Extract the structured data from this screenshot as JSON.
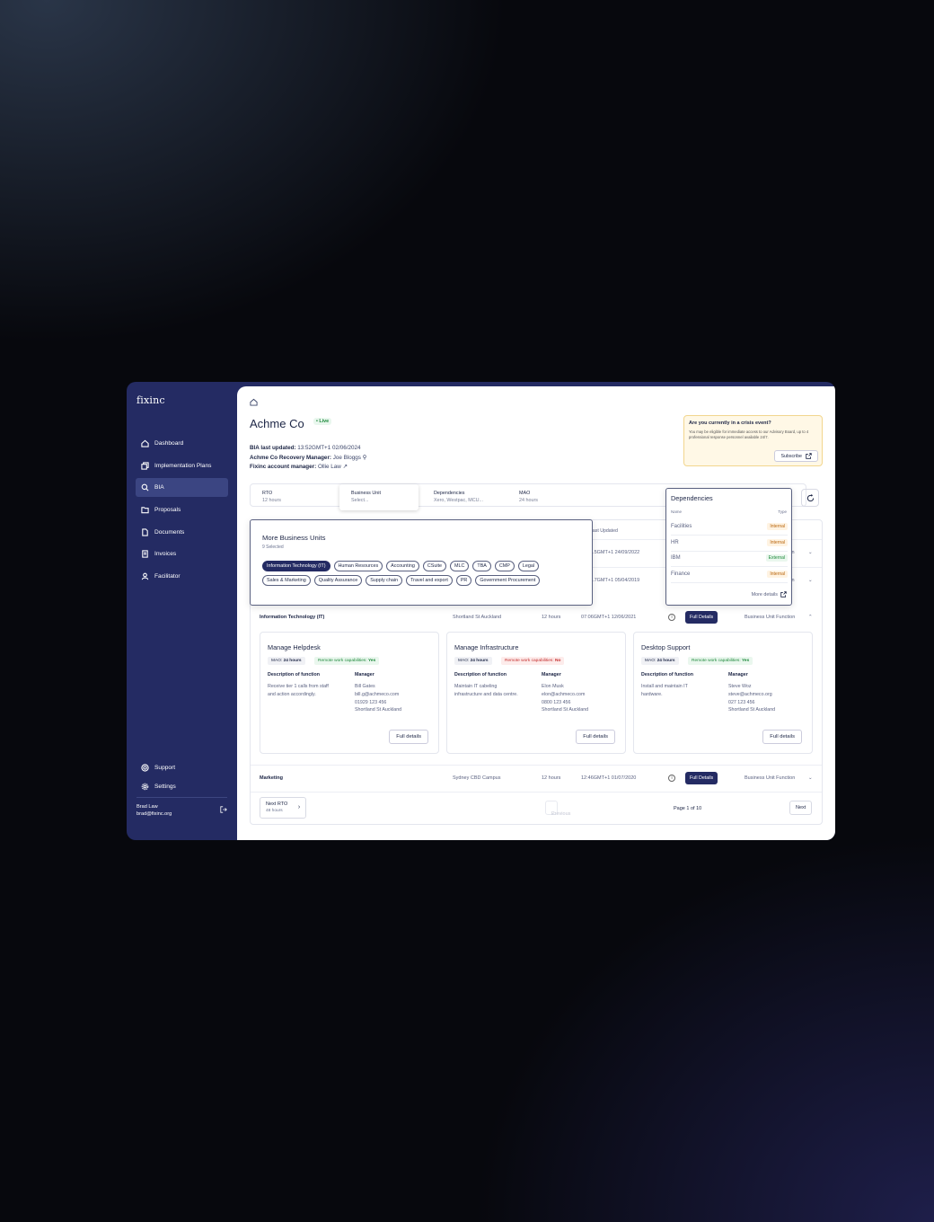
{
  "app": {
    "logo": "fixinc"
  },
  "sidebar": {
    "items": [
      {
        "label": "Dashboard",
        "icon": "home-icon"
      },
      {
        "label": "Implementation Plans",
        "icon": "layers-icon"
      },
      {
        "label": "BIA",
        "icon": "search-icon",
        "active": true
      },
      {
        "label": "Proposals",
        "icon": "folder-icon"
      },
      {
        "label": "Documents",
        "icon": "document-icon"
      },
      {
        "label": "Invoices",
        "icon": "invoice-icon"
      },
      {
        "label": "Facilitator",
        "icon": "user-icon"
      }
    ],
    "bottom": [
      {
        "label": "Support",
        "icon": "lifebuoy-icon"
      },
      {
        "label": "Settings",
        "icon": "gear-icon"
      }
    ],
    "user": {
      "name": "Brad Law",
      "email": "brad@fixinc.org"
    }
  },
  "header": {
    "title": "Achme Co",
    "status": "• Live",
    "bia_updated_label": "BIA last updated:",
    "bia_updated_value": "13:52GMT+1 02/06/2024",
    "recovery_manager_label": "Achme Co Recovery Manager:",
    "recovery_manager_value": "Joe Bloggs",
    "account_manager_label": "Fixinc account manager:",
    "account_manager_value": "Ollie Law"
  },
  "crisis": {
    "title": "Are you currently in a crisis event?",
    "body": "You may be eligible for immediate access to our Advisory Board, up to 4 professional response personnel available 24/7.",
    "button": "Subscribe"
  },
  "filters": {
    "rto": {
      "label": "RTO",
      "value": "12 hours"
    },
    "business_unit": {
      "label": "Business Unit",
      "value": "Select..."
    },
    "dependencies": {
      "label": "Dependencies",
      "value": "Xero, Westpac, MCU..."
    },
    "mao": {
      "label": "MAO",
      "value": "24 hours"
    }
  },
  "table": {
    "header_last_updated": "Last Updated",
    "rows": [
      {
        "time": "...5GMT+1 24/09/2022",
        "tail": "ction"
      },
      {
        "time": "...7GMT+1 05/04/2019",
        "tail": "ction"
      },
      {
        "name": "Information Technology (IT)",
        "location": "Shortland St Auckland",
        "rto": "12 hours",
        "time": "07:06GMT+1 12/06/2021",
        "button": "Full Details",
        "type": "Business Unit Function"
      },
      {
        "name": "Marketing",
        "location": "Sydney CBD Campus",
        "rto": "12 hours",
        "time": "12:46GMT+1 01/07/2020",
        "button": "Full Details",
        "type": "Business Unit Function"
      }
    ]
  },
  "cards": [
    {
      "title": "Manage Helpdesk",
      "mao_label": "MAO:",
      "mao": "24 hours",
      "remote_label": "Remote work capabilities:",
      "remote": "Yes",
      "desc_label": "Description of function",
      "desc": [
        "Receive tier 1 calls from staff",
        "and action accordingly."
      ],
      "manager_label": "Manager",
      "manager": [
        "Bill Gates",
        "bill.g@achmeco.com",
        "01929 123 456",
        "Shortland St Auckland"
      ],
      "button": "Full details"
    },
    {
      "title": "Manage Infrastructure",
      "mao_label": "MAO:",
      "mao": "24 hours",
      "remote_label": "Remote work capabilities:",
      "remote": "No",
      "desc_label": "Description of function",
      "desc": [
        "Maintain IT cabeling",
        "infrastructure and data centre."
      ],
      "manager_label": "Manager",
      "manager": [
        "Elon Musk",
        "elon@achmeco.com",
        "0800 123 456",
        "Shortland St Auckland"
      ],
      "button": "Full details"
    },
    {
      "title": "Desktop Support",
      "mao_label": "MAO:",
      "mao": "24 hours",
      "remote_label": "Remote work capabilities:",
      "remote": "Yes",
      "desc_label": "Description of function",
      "desc": [
        "Install and maintain IT",
        "hardware."
      ],
      "manager_label": "Manager",
      "manager": [
        "Steve Woz",
        "steve@achmeco.org",
        "027 123 456",
        "Shortland St Auckland"
      ],
      "button": "Full details"
    }
  ],
  "pagination": {
    "next_rto_label": "Next RTO",
    "next_rto_value": "48 hours",
    "previous": "Previous",
    "page": "Page 1 of 10",
    "next": "Next"
  },
  "business_units_popup": {
    "title": "More Business Units",
    "subtitle": "9 Selected",
    "chips": [
      {
        "label": "Information Technology (IT)",
        "selected": true
      },
      {
        "label": "Human Resources"
      },
      {
        "label": "Accounting"
      },
      {
        "label": "CSuite"
      },
      {
        "label": "MLC"
      },
      {
        "label": "TBA"
      },
      {
        "label": "CMP"
      },
      {
        "label": "Legal"
      },
      {
        "label": "Sales & Marketing"
      },
      {
        "label": "Quality Assurance"
      },
      {
        "label": "Supply chain"
      },
      {
        "label": "Travel and export"
      },
      {
        "label": "PR"
      },
      {
        "label": "Government Procurement"
      }
    ]
  },
  "dependencies_popup": {
    "title": "Dependencies",
    "col_name": "Name",
    "col_type": "Type",
    "rows": [
      {
        "name": "Facilities",
        "type": "Internal"
      },
      {
        "name": "HR",
        "type": "Internal"
      },
      {
        "name": "IBM",
        "type": "External"
      },
      {
        "name": "Finance",
        "type": "Internal"
      }
    ],
    "more": "More details"
  }
}
